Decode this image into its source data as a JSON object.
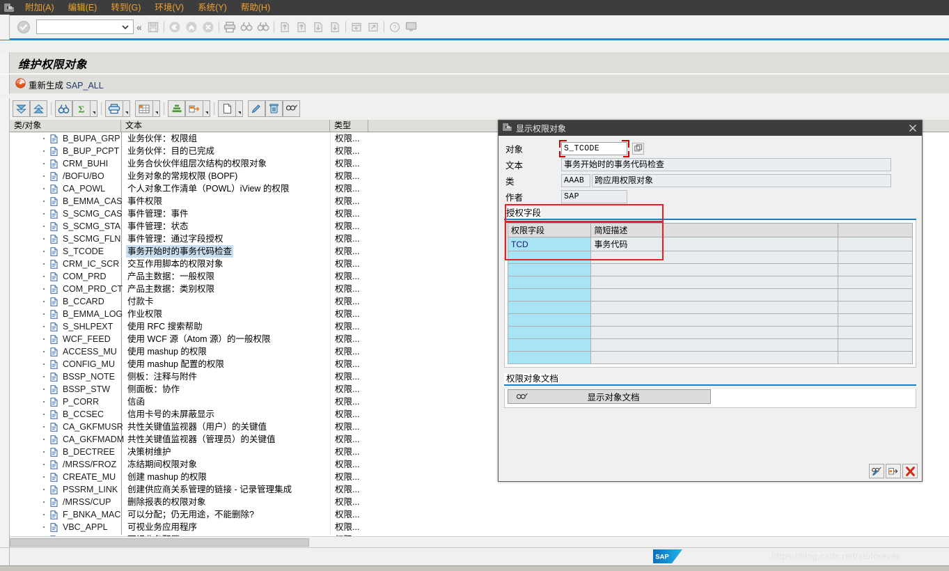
{
  "menubar": {
    "window_icon": "sap-window-icon",
    "items": [
      {
        "label": "附加(A)",
        "accel": "A"
      },
      {
        "label": "编辑(E)",
        "accel": "E"
      },
      {
        "label": "转到(G)",
        "accel": "G"
      },
      {
        "label": "环境(V)",
        "accel": "V"
      },
      {
        "label": "系统(Y)",
        "accel": "Y"
      },
      {
        "label": "帮助(H)",
        "accel": "H"
      }
    ]
  },
  "toolbar": {
    "enter_icon": "green-check-icon",
    "command_field": {
      "value": "",
      "placeholder": ""
    },
    "dropdown_icon": "chevron-down-icon",
    "expand_icon": "double-chevron-left-icon",
    "icons": [
      "save-icon",
      "back-icon",
      "exit-icon",
      "cancel-icon",
      "print-icon",
      "find-icon",
      "find-next-icon",
      "first-page-icon",
      "previous-page-icon",
      "next-page-icon",
      "last-page-icon",
      "create-session-icon",
      "create-shortcut-icon",
      "help-icon",
      "customize-local-layout-icon"
    ]
  },
  "page": {
    "title": "维护权限对象"
  },
  "action_bar": {
    "regenerate_icon": "regenerate-icon",
    "regenerate_label": "重新生成 ",
    "regenerate_code": "SAP_ALL"
  },
  "toolbar2": {
    "buttons": [
      {
        "name": "expand-all-button",
        "icon": "expand-all-icon",
        "dropdown": false
      },
      {
        "name": "collapse-all-button",
        "icon": "collapse-all-icon",
        "dropdown": false
      },
      {
        "name": "find-button",
        "icon": "binoculars-icon",
        "dropdown": false
      },
      {
        "name": "total-button",
        "icon": "sigma-icon",
        "dropdown": true
      },
      {
        "name": "print-button",
        "icon": "printer-icon",
        "dropdown": true
      },
      {
        "name": "layout-button",
        "icon": "grid-layout-icon",
        "dropdown": true
      },
      {
        "name": "subtotal-button",
        "icon": "subtotal-icon",
        "dropdown": false
      },
      {
        "name": "export-button",
        "icon": "export-icon",
        "dropdown": true
      },
      {
        "name": "new-button",
        "icon": "new-document-icon",
        "dropdown": true
      },
      {
        "name": "edit-button",
        "icon": "pencil-icon",
        "dropdown": false
      },
      {
        "name": "delete-button",
        "icon": "trash-icon",
        "dropdown": false
      },
      {
        "name": "display-doc-button",
        "icon": "glasses-pencil-icon",
        "dropdown": false
      }
    ]
  },
  "grid": {
    "columns": [
      "类/对象",
      "文本",
      "类型",
      ""
    ],
    "type_value": "权限...",
    "selected_row_index": 9,
    "rows": [
      {
        "object": "B_BUPA_GRP",
        "text": "业务伙伴：权限组"
      },
      {
        "object": "B_BUP_PCPT",
        "text": "业务伙伴：目的已完成"
      },
      {
        "object": "CRM_BUHI",
        "text": "业务合伙伙伴组层次结构的权限对象"
      },
      {
        "object": "/BOFU/BO",
        "text": "业务对象的常规权限 (BOPF)"
      },
      {
        "object": "CA_POWL",
        "text": "个人对象工作清单（POWL）iView 的权限"
      },
      {
        "object": "B_EMMA_CAS",
        "text": "事件权限"
      },
      {
        "object": "S_SCMG_CAS",
        "text": "事件管理：事件"
      },
      {
        "object": "S_SCMG_STA",
        "text": "事件管理：状态"
      },
      {
        "object": "S_SCMG_FLN",
        "text": "事件管理：通过字段授权"
      },
      {
        "object": "S_TCODE",
        "text": "事务开始时的事务代码检查"
      },
      {
        "object": "CRM_IC_SCR",
        "text": "交互作用脚本的权限对象"
      },
      {
        "object": "COM_PRD",
        "text": "产品主数据：一般权限"
      },
      {
        "object": "COM_PRD_CT",
        "text": "产品主数据：类别权限"
      },
      {
        "object": "B_CCARD",
        "text": "付款卡"
      },
      {
        "object": "B_EMMA_LOG",
        "text": "作业权限"
      },
      {
        "object": "S_SHLPEXT",
        "text": "使用 RFC 搜索帮助"
      },
      {
        "object": "WCF_FEED",
        "text": "使用 WCF 源（Atom 源）的一般权限"
      },
      {
        "object": "ACCESS_MU",
        "text": "使用 mashup 的权限"
      },
      {
        "object": "CONFIG_MU",
        "text": "使用 mashup 配置的权限"
      },
      {
        "object": "BSSP_NOTE",
        "text": "侧板：注释与附件"
      },
      {
        "object": "BSSP_STW",
        "text": "侧面板：协作"
      },
      {
        "object": "P_CORR",
        "text": "信函"
      },
      {
        "object": "B_CCSEC",
        "text": "信用卡号的未屏蔽显示"
      },
      {
        "object": "CA_GKFMUSR",
        "text": "共性关键值监视器（用户）的关键值"
      },
      {
        "object": "CA_GKFMADM",
        "text": "共性关键值监视器（管理员）的关键值"
      },
      {
        "object": "B_DECTREE",
        "text": "决策树维护"
      },
      {
        "object": "/MRSS/FROZ",
        "text": "冻结期间权限对象"
      },
      {
        "object": "CREATE_MU",
        "text": "创建 mashup 的权限"
      },
      {
        "object": "PSSRM_LINK",
        "text": "创建供应商关系管理的链接 - 记录管理集成"
      },
      {
        "object": "/MRSS/CUP",
        "text": "删除报表的权限对象"
      },
      {
        "object": "F_BNKA_MAC",
        "text": "可以分配；仍无用途，不能删除?"
      },
      {
        "object": "VBC_APPL",
        "text": "可视业务应用程序"
      },
      {
        "object": "VBC_CONF",
        "text": "可视业务配置"
      }
    ]
  },
  "dialog": {
    "window_icon": "sap-window-icon",
    "title": "显示权限对象",
    "close_icon": "close-icon",
    "fields": [
      {
        "label": "对象",
        "value": "S_TCODE",
        "focused": true,
        "help_icon": "search-help-icon"
      },
      {
        "label": "文本",
        "value": "事务开始时的事务代码检查",
        "focused": false
      },
      {
        "label": "类",
        "value": "AAAB",
        "value2": "跨应用权限对象",
        "focused": false
      },
      {
        "label": "作者",
        "value": "SAP",
        "focused": false
      }
    ],
    "auth_fields_group": {
      "label": "授权字段",
      "columns": [
        "权限字段",
        "简短描述"
      ],
      "rows": [
        {
          "field": "TCD",
          "description": "事务代码"
        },
        {
          "field": "",
          "description": ""
        },
        {
          "field": "",
          "description": ""
        },
        {
          "field": "",
          "description": ""
        },
        {
          "field": "",
          "description": ""
        },
        {
          "field": "",
          "description": ""
        },
        {
          "field": "",
          "description": ""
        },
        {
          "field": "",
          "description": ""
        },
        {
          "field": "",
          "description": ""
        },
        {
          "field": "",
          "description": ""
        }
      ]
    },
    "doc_group": {
      "label": "权限对象文档",
      "button_icon": "glasses-pencil-icon",
      "button_label": "显示对象文档"
    },
    "footer_buttons": [
      {
        "name": "display-change-button",
        "icon": "glasses-pencil-icon"
      },
      {
        "name": "transfer-button",
        "icon": "transfer-icon"
      },
      {
        "name": "cancel-button",
        "icon": "red-x-icon"
      }
    ]
  },
  "statusbar": {
    "logo": "sap-logo",
    "logo_text": "SAP",
    "watermark": "https://blog.csdn.net/stuforever"
  },
  "colors": {
    "menu_bg": "#3d3d3d",
    "menu_text": "#f0a030",
    "accent_blue": "#1e8ac8",
    "selection": "#c9dff0",
    "key_column": "#a7e4f5",
    "annotation_red": "#ee1c24",
    "sap_blue": "#0f7dc2"
  }
}
